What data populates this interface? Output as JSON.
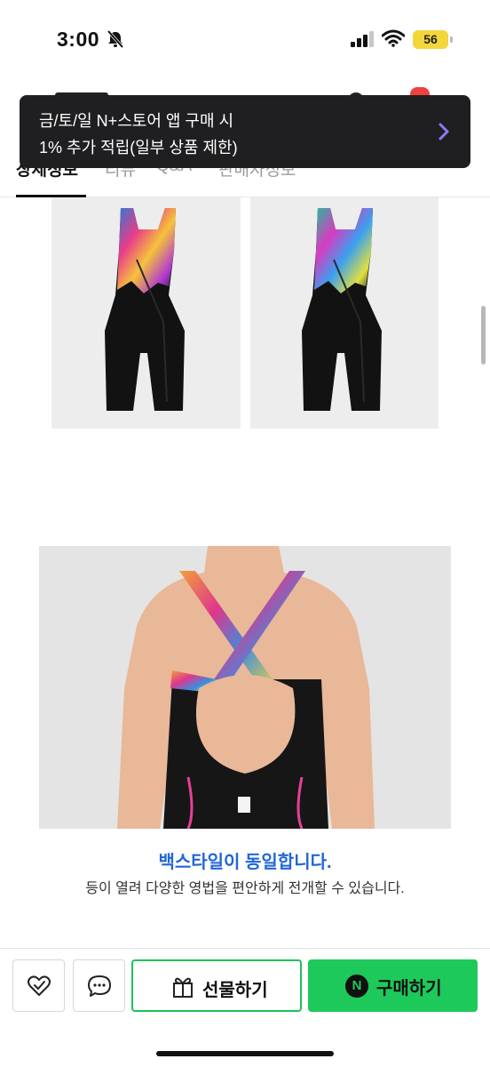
{
  "status_bar": {
    "time": "3:00",
    "battery": "56",
    "icons": [
      "bell-slash-icon",
      "cellular-signal-icon",
      "wifi-icon",
      "battery-icon"
    ]
  },
  "toast": {
    "line1": "금/토/일 N+스토어 앱 구매 시",
    "line2": "1% 추가 적립(일부 상품 제한)",
    "icon": "chevron-right-icon",
    "accent": "#8b7cf6"
  },
  "tabs": {
    "items": [
      "상세정보",
      "리뷰",
      "Q&A",
      "판매자정보"
    ],
    "active_index": 0
  },
  "product": {
    "caption_title": "백스타일이 동일합니다.",
    "caption_subtitle": "등이 열려 다양한 영법을 편안하게 전개할 수 있습니다."
  },
  "bottom_bar": {
    "like_icon": "heart-check-icon",
    "talk_icon": "chat-bubble-icon",
    "gift_label": "선물하기",
    "gift_icon": "gift-icon",
    "buy_label": "구매하기",
    "buy_badge": "N",
    "brand_color": "#1ec95b"
  },
  "colors": {
    "link_blue": "#2266d6",
    "toast_bg": "#1f1f21",
    "battery_yellow": "#f3d63a"
  }
}
